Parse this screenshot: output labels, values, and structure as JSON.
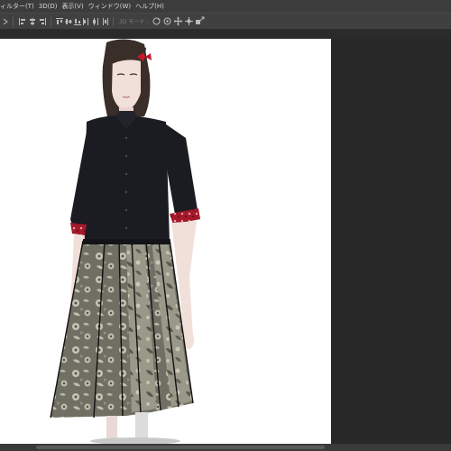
{
  "menubar": {
    "items": [
      {
        "label": "ィルター(T)"
      },
      {
        "label": "3D(D)"
      },
      {
        "label": "表示(V)"
      },
      {
        "label": "ウィンドウ(W)"
      },
      {
        "label": "ヘルプ(H)"
      }
    ]
  },
  "optionsbar": {
    "mode3d_label": "3D モード :",
    "icons": [
      "arrow-icon",
      "align-left-icon",
      "align-center-icon",
      "align-right-icon",
      "distribute-top-icon",
      "distribute-middle-icon",
      "distribute-bottom-icon",
      "distribute-left-icon",
      "distribute-center-icon",
      "distribute-right-icon",
      "3d-rotate-icon",
      "3d-roll-icon",
      "3d-pan-icon",
      "3d-slide-icon",
      "3d-scale-icon"
    ]
  },
  "canvas": {
    "content": "fashion illustration: woman in black blouse with red cuffs and grey floral pleated skirt",
    "colors": {
      "blouse": "#1b1c22",
      "skirt": "#6f6f63",
      "accent": "#b01c2c",
      "hair": "#3a2e28",
      "skin": "#f1e0da"
    }
  }
}
